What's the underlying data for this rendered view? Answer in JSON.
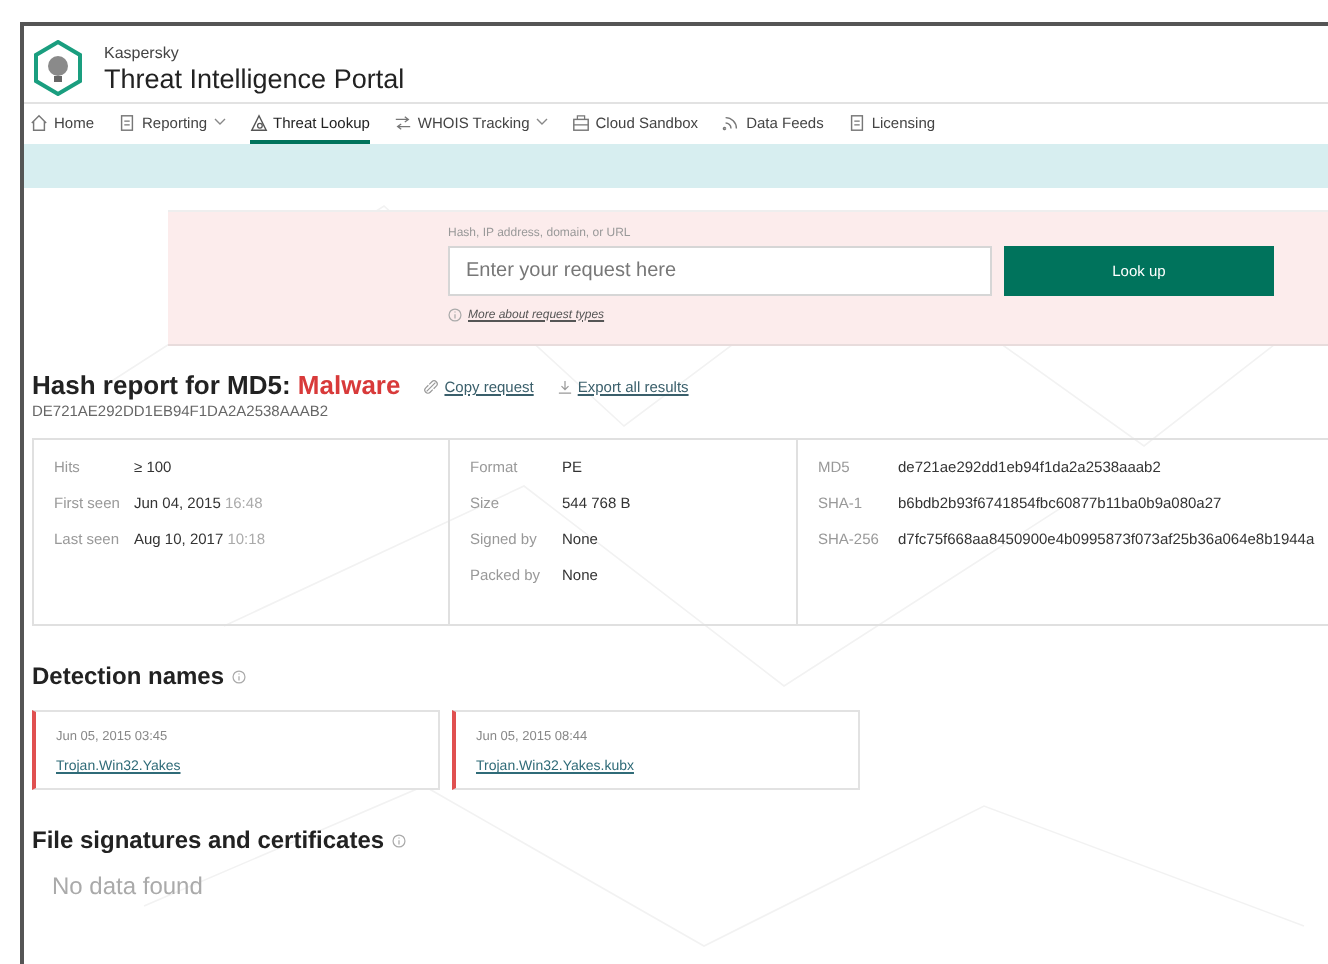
{
  "header": {
    "brand": "Kaspersky",
    "title": "Threat Intelligence Portal"
  },
  "nav": [
    {
      "label": "Home",
      "kind": "home",
      "has_menu": false,
      "selected": false
    },
    {
      "label": "Reporting",
      "kind": "doc",
      "has_menu": true,
      "selected": false
    },
    {
      "label": "Threat Lookup",
      "kind": "lookup",
      "has_menu": false,
      "selected": true
    },
    {
      "label": "WHOIS Tracking",
      "kind": "arrows",
      "has_menu": true,
      "selected": false
    },
    {
      "label": "Cloud Sandbox",
      "kind": "box",
      "has_menu": false,
      "selected": false
    },
    {
      "label": "Data Feeds",
      "kind": "feed",
      "has_menu": false,
      "selected": false
    },
    {
      "label": "Licensing",
      "kind": "doc",
      "has_menu": false,
      "selected": false
    }
  ],
  "search": {
    "label": "Hash, IP address, domain, or URL",
    "placeholder": "Enter your request here",
    "button": "Look up",
    "help_link": "More about request types"
  },
  "report": {
    "title": "Hash report for MD5:",
    "verdict": "Malware",
    "actions": [
      {
        "label": "Copy request",
        "kind": "link"
      },
      {
        "label": "Export all results",
        "kind": "download"
      }
    ],
    "hash": "DE721AE292DD1EB94F1DA2A2538AAAB2"
  },
  "info_columns": [
    [
      {
        "label": "Hits",
        "value": "≥ 100"
      },
      {
        "label": "First seen",
        "value": "Jun 04, 2015",
        "time": "16:48"
      },
      {
        "label": "Last seen",
        "value": "Aug 10, 2017",
        "time": "10:18"
      }
    ],
    [
      {
        "label": "Format",
        "value": "PE"
      },
      {
        "label": "Size",
        "value": "544 768 B"
      },
      {
        "label": "Signed by",
        "value": "None"
      },
      {
        "label": "Packed by",
        "value": "None"
      }
    ],
    [
      {
        "label": "MD5",
        "value": "de721ae292dd1eb94f1da2a2538aaab2"
      },
      {
        "label": "SHA-1",
        "value": "b6bdb2b93f6741854fbc60877b11ba0b9a080a27"
      },
      {
        "label": "SHA-256",
        "value": "d7fc75f668aa8450900e4b0995873f073af25b36a064e8b1944a"
      }
    ]
  ],
  "detection": {
    "title": "Detection names",
    "items": [
      {
        "date": "Jun 05, 2015 03:45",
        "name": "Trojan.Win32.Yakes"
      },
      {
        "date": "Jun 05, 2015 08:44",
        "name": "Trojan.Win32.Yakes.kubx"
      }
    ]
  },
  "signatures": {
    "title": "File signatures and certificates",
    "empty": "No data found"
  }
}
